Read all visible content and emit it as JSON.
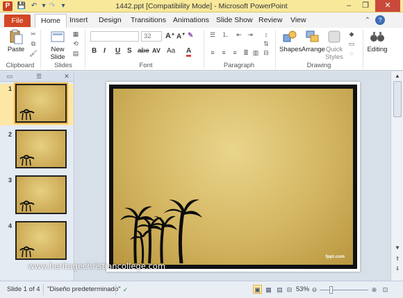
{
  "window": {
    "title": "1442.ppt [Compatibility Mode] - Microsoft PowerPoint",
    "app_letter": "P",
    "controls": {
      "minimize": "–",
      "maximize": "❐",
      "close": "✕"
    }
  },
  "quick_access": {
    "save": "💾",
    "undo": "↶",
    "redo": "↷",
    "customize": "▾"
  },
  "ribbon_tabs": [
    "File",
    "Home",
    "Insert",
    "Design",
    "Transitions",
    "Animations",
    "Slide Show",
    "Review",
    "View"
  ],
  "active_tab": "Home",
  "ribbon": {
    "clipboard": {
      "label": "Clipboard",
      "paste": "Paste"
    },
    "slides": {
      "label": "Slides",
      "new_slide_line1": "New",
      "new_slide_line2": "Slide"
    },
    "font": {
      "label": "Font",
      "font_name": "",
      "font_size": "32",
      "format_buttons": [
        "B",
        "I",
        "U",
        "S",
        "abe",
        "AV",
        "Aa",
        "A"
      ]
    },
    "paragraph": {
      "label": "Paragraph"
    },
    "drawing": {
      "label": "Drawing",
      "shapes": "Shapes",
      "arrange": "Arrange",
      "quick_styles_line1": "Quick",
      "quick_styles_line2": "Styles"
    },
    "editing": {
      "label": "Editing"
    }
  },
  "thumbnails": [
    {
      "number": "1",
      "selected": true
    },
    {
      "number": "2",
      "selected": false
    },
    {
      "number": "3",
      "selected": false
    },
    {
      "number": "4",
      "selected": false
    }
  ],
  "slide": {
    "footer_text": "fppt.com"
  },
  "watermark": "www.heritagechristiancollege.com",
  "status": {
    "slide_info": "Slide 1 of 4",
    "theme": "\"Diseño predeterminado\"",
    "zoom": "53%"
  },
  "colors": {
    "file_tab": "#d24726",
    "title_bar": "#f8e89a",
    "parchment": "#d4b662",
    "selection": "#fde7a6"
  }
}
